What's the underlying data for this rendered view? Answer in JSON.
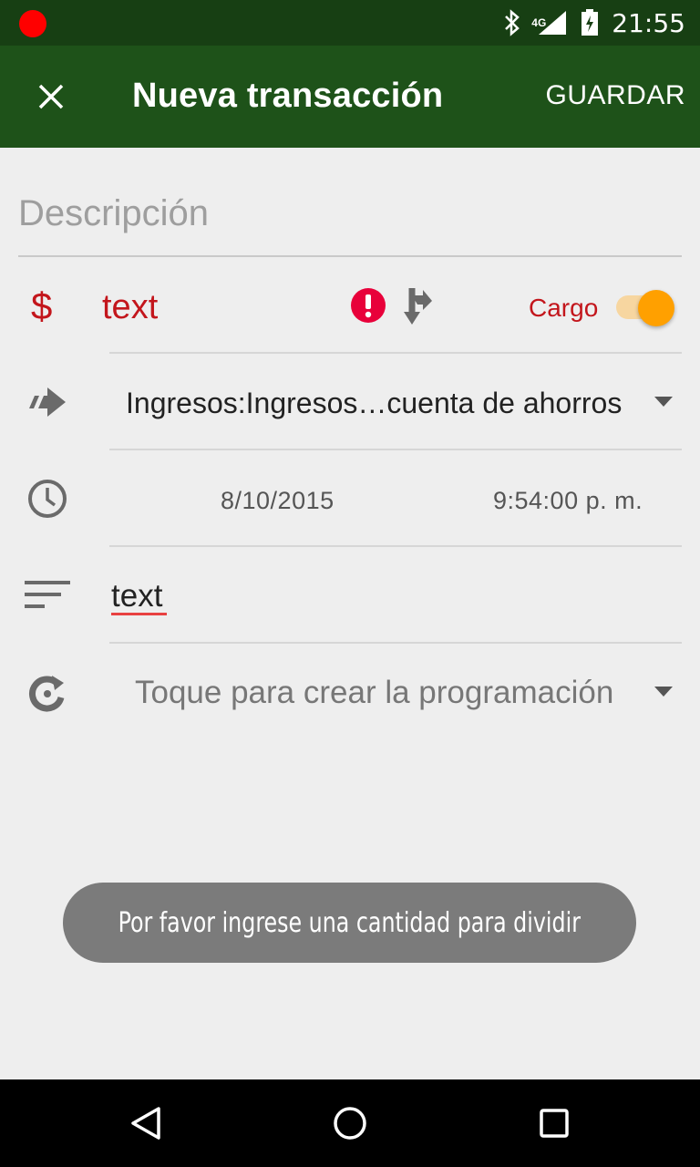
{
  "status_bar": {
    "time": "21:55",
    "network": "4G",
    "icons": [
      "recording-dot",
      "bluetooth-icon",
      "signal-icon",
      "battery-charging-icon"
    ]
  },
  "app_bar": {
    "title": "Nueva transacción",
    "save_label": "GUARDAR",
    "close_icon": "close-icon"
  },
  "form": {
    "description_placeholder": "Descripción",
    "currency_symbol": "$",
    "amount_value": "text",
    "transaction_type_label": "Cargo",
    "transaction_type_toggle_on": true,
    "account": "Ingresos:Ingresos…cuenta de ahorros",
    "date": "8/10/2015",
    "time": "9:54:00 p. m.",
    "notes_value": "text",
    "schedule_placeholder": "Toque para crear la programación"
  },
  "toast": {
    "message": "Por favor ingrese una cantidad para dividir"
  },
  "colors": {
    "status_bar": "#173f13",
    "app_bar": "#1e5219",
    "amount_red": "#c3161c",
    "toggle_accent": "#ffa000",
    "alert_red": "#e8003a",
    "background": "#eeeeee"
  },
  "nav_bar": {
    "icons": [
      "back-icon",
      "home-icon",
      "recents-icon"
    ]
  }
}
